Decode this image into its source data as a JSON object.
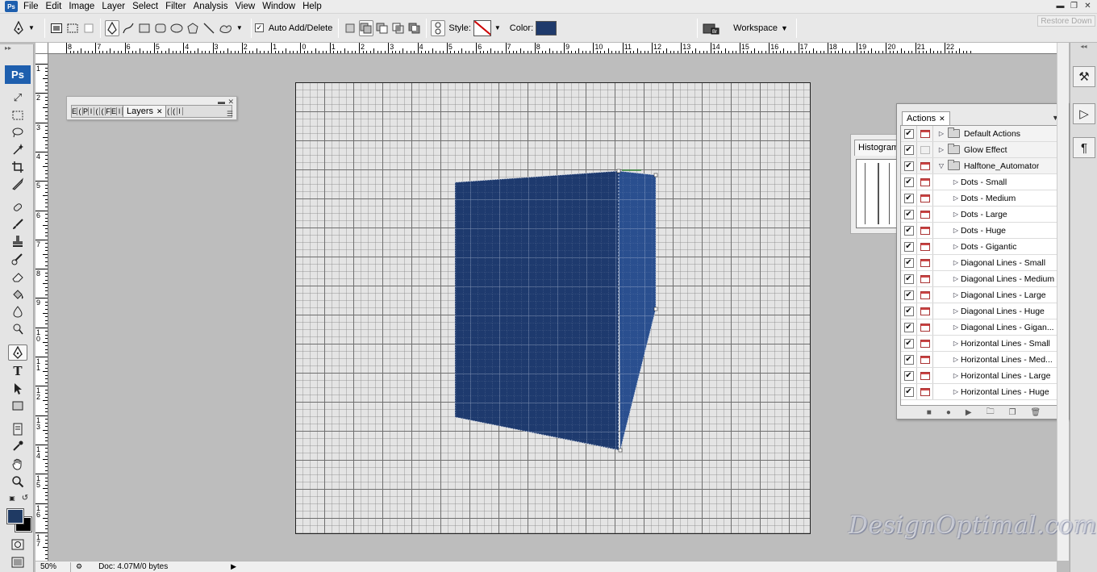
{
  "menu": {
    "items": [
      "File",
      "Edit",
      "Image",
      "Layer",
      "Select",
      "Filter",
      "Analysis",
      "View",
      "Window",
      "Help"
    ]
  },
  "window_controls": [
    "minimize-icon",
    "restore-icon",
    "close-icon"
  ],
  "options_bar": {
    "auto_add_delete_label": "Auto Add/Delete",
    "auto_add_delete_checked": true,
    "style_label": "Style:",
    "color_label": "Color:",
    "color_value": "#1f3a6b",
    "workspace_label": "Workspace",
    "restore_down_label": "Restore Down"
  },
  "toolbox": {
    "badge": "Ps",
    "foreground_color": "#1f3a63",
    "background_color": "#000000"
  },
  "rulers": {
    "top_labels": [
      "8",
      "7",
      "6",
      "5",
      "4",
      "3",
      "2",
      "1",
      "0",
      "1",
      "2",
      "3",
      "4",
      "5",
      "6",
      "7",
      "8",
      "9",
      "10",
      "11",
      "12",
      "13",
      "14",
      "15",
      "16",
      "17",
      "18",
      "19",
      "20",
      "21",
      "22"
    ],
    "left_labels": [
      "1",
      "2",
      "3",
      "4",
      "5",
      "6",
      "7",
      "8",
      "9",
      "10",
      "11",
      "12",
      "13",
      "14",
      "15",
      "16",
      "17"
    ]
  },
  "layers_panel": {
    "tab_label": "Layers"
  },
  "histogram_panel": {
    "tab_label": "Histogram"
  },
  "actions_panel": {
    "tab_label": "Actions",
    "rows": [
      {
        "label": "Default Actions",
        "type": "set",
        "expanded": false,
        "checked": true,
        "dialog": true
      },
      {
        "label": "Glow Effect",
        "type": "set",
        "expanded": false,
        "checked": true,
        "dialog": false
      },
      {
        "label": "Halftone_Automator",
        "type": "set",
        "expanded": true,
        "checked": true,
        "dialog": true
      },
      {
        "label": "Dots - Small",
        "type": "action",
        "checked": true,
        "dialog": true
      },
      {
        "label": "Dots - Medium",
        "type": "action",
        "checked": true,
        "dialog": true
      },
      {
        "label": "Dots - Large",
        "type": "action",
        "checked": true,
        "dialog": true
      },
      {
        "label": "Dots - Huge",
        "type": "action",
        "checked": true,
        "dialog": true
      },
      {
        "label": "Dots - Gigantic",
        "type": "action",
        "checked": true,
        "dialog": true
      },
      {
        "label": "Diagonal Lines - Small",
        "type": "action",
        "checked": true,
        "dialog": true
      },
      {
        "label": "Diagonal Lines - Medium",
        "type": "action",
        "checked": true,
        "dialog": true
      },
      {
        "label": "Diagonal Lines - Large",
        "type": "action",
        "checked": true,
        "dialog": true
      },
      {
        "label": "Diagonal Lines - Huge",
        "type": "action",
        "checked": true,
        "dialog": true
      },
      {
        "label": "Diagonal Lines - Gigan...",
        "type": "action",
        "checked": true,
        "dialog": true
      },
      {
        "label": "Horizontal Lines - Small",
        "type": "action",
        "checked": true,
        "dialog": true
      },
      {
        "label": "Horizontal Lines - Med...",
        "type": "action",
        "checked": true,
        "dialog": true
      },
      {
        "label": "Horizontal Lines - Large",
        "type": "action",
        "checked": true,
        "dialog": true
      },
      {
        "label": "Horizontal Lines - Huge",
        "type": "action",
        "checked": true,
        "dialog": true
      }
    ],
    "footer_icons": [
      "stop-icon",
      "record-icon",
      "play-icon",
      "new-set-icon",
      "new-action-icon",
      "delete-icon"
    ]
  },
  "canvas": {
    "shape_color": "#1e3a6e",
    "shape_side_color": "#2a4f8f"
  },
  "status_bar": {
    "zoom": "50%",
    "doc_info": "Doc: 4.07M/0 bytes"
  },
  "watermark": {
    "text": "DesignOptimal.com"
  }
}
